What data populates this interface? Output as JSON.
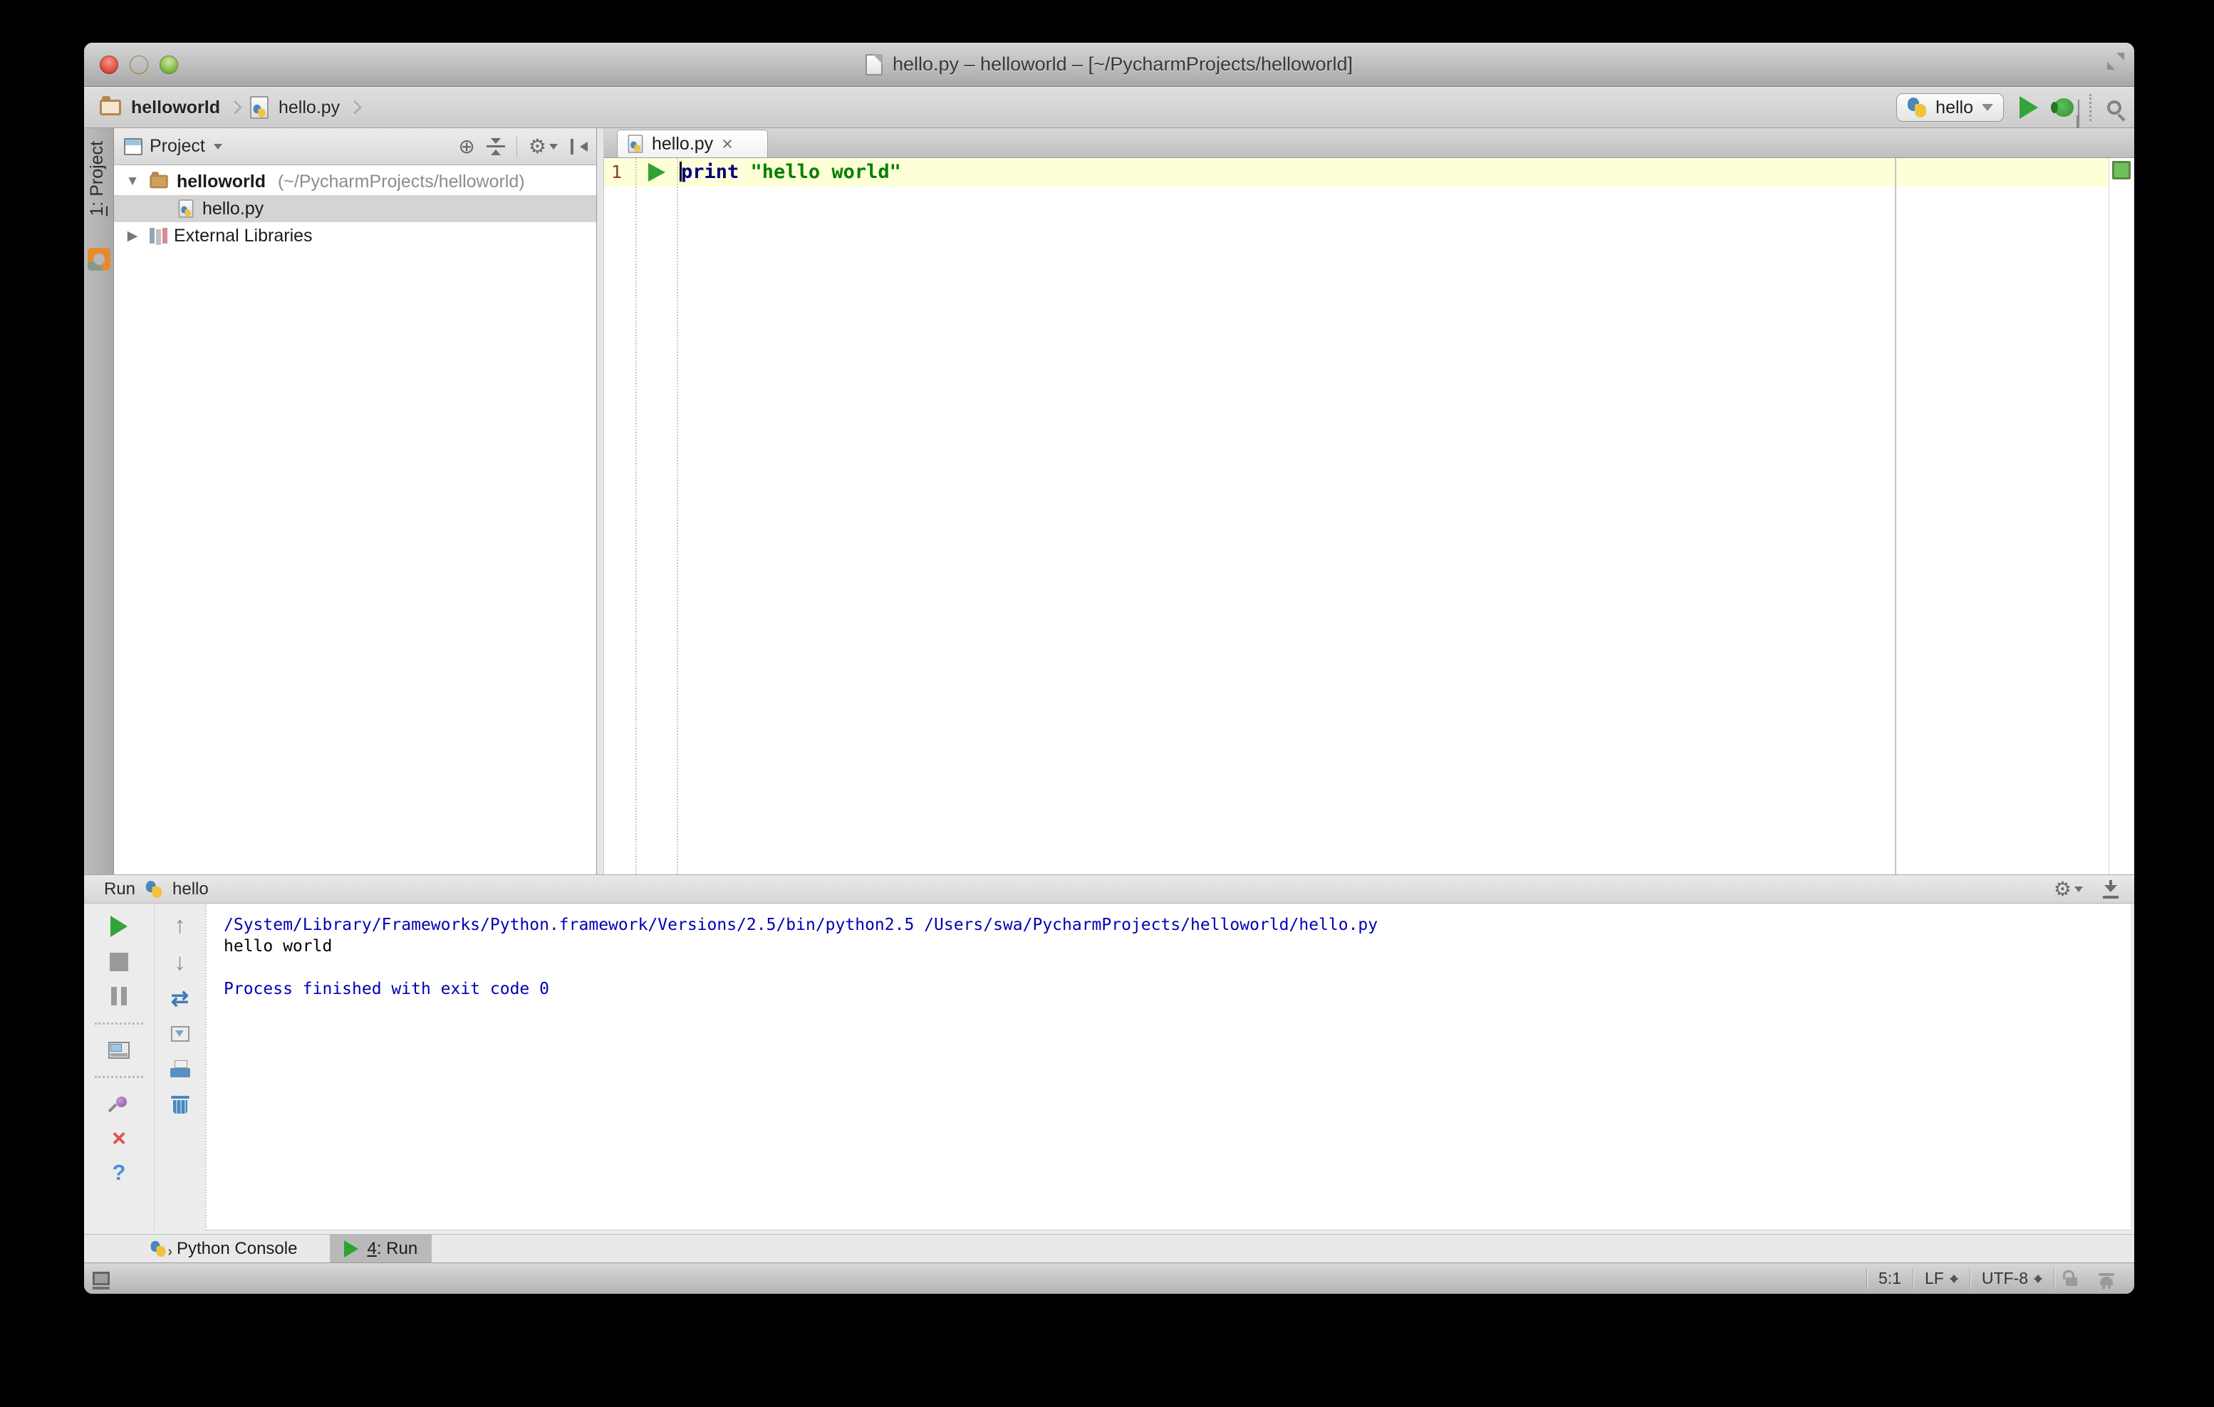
{
  "titlebar": {
    "title": "hello.py – helloworld – [~/PycharmProjects/helloworld]"
  },
  "breadcrumbs": {
    "folder": "helloworld",
    "file": "hello.py"
  },
  "navbar": {
    "run_config": "hello"
  },
  "tool_stripe": {
    "num": "1",
    "rest": ": Project"
  },
  "project_panel": {
    "header_label": "Project",
    "tree": {
      "root_name": "helloworld",
      "root_path": " (~/PycharmProjects/helloworld)",
      "file": "hello.py",
      "external": "External Libraries"
    }
  },
  "editor": {
    "tab_label": "hello.py",
    "tab_close": "×",
    "line_number": "1",
    "code_keyword": "print ",
    "code_string": "\"hello world\""
  },
  "run_panel": {
    "label": "Run",
    "config_name": "hello",
    "console": [
      {
        "text": "/System/Library/Frameworks/Python.framework/Versions/2.5/bin/python2.5 /Users/swa/PycharmProjects/helloworld/hello.py"
      },
      {
        "text": "hello world"
      },
      {
        "text": ""
      },
      {
        "text": "Process finished with exit code 0"
      }
    ],
    "help_label": "?"
  },
  "bottom_bar": {
    "python_console": "Python Console",
    "run_num": "4",
    "run_rest": ": Run"
  },
  "status_bar": {
    "caret_position": "5:1",
    "line_separator": "LF",
    "encoding": "UTF-8"
  },
  "colors": {
    "keyword": "#000080",
    "string": "#008000",
    "console_info": "#0000b2",
    "line_number": "#8b3a3a",
    "ok_marker": "#6fc05a",
    "active_line": "#FFFFD7"
  }
}
